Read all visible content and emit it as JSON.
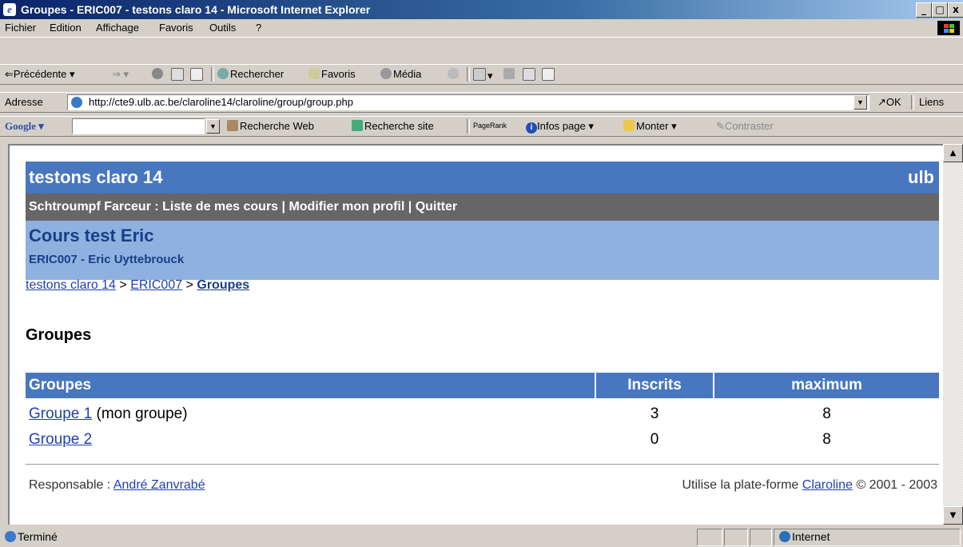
{
  "window": {
    "title": "Groupes - ERIC007 - testons claro 14 - Microsoft Internet Explorer",
    "min_glyph": "_",
    "max_glyph": "□",
    "close_glyph": "x"
  },
  "menu": {
    "items": [
      "Fichier",
      "Edition",
      "Affichage",
      "Favoris",
      "Outils",
      "?"
    ]
  },
  "toolbar": {
    "back": "Précédente",
    "search": "Rechercher",
    "favorites": "Favoris",
    "media": "Média"
  },
  "address": {
    "label": "Adresse",
    "url": "http://cte9.ulb.ac.be/claroline14/claroline/group/group.php",
    "go": "OK",
    "links": "Liens"
  },
  "google_bar": {
    "brand": "Google",
    "search_value": "",
    "web_search": "Recherche Web",
    "site_search": "Recherche site",
    "pagerank": "PageRank",
    "page_info": "Infos page",
    "up": "Monter",
    "highlight": "Contraster"
  },
  "page": {
    "campus_name": "testons claro 14",
    "institution": "ulb",
    "user_bar": "Schtroumpf Farceur : Liste de mes cours | Modifier mon profil | Quitter",
    "course_title": "Cours test Eric",
    "course_code_teacher": "ERIC007 - Eric Uyttebrouck",
    "breadcrumb": {
      "home": "testons claro 14",
      "sep1": ">",
      "course": "ERIC007",
      "sep2": ">",
      "current": "Groupes"
    },
    "heading": "Groupes",
    "table": {
      "headers": [
        "Groupes",
        "Inscrits",
        "maximum"
      ],
      "rows": [
        {
          "name": "Groupe 1",
          "note": "(mon groupe)",
          "enrolled": "3",
          "max": "8"
        },
        {
          "name": "Groupe 2",
          "note": "",
          "enrolled": "0",
          "max": "8"
        }
      ]
    },
    "footer": {
      "manager_label": "Responsable :",
      "manager_name": "André Zanvrabé",
      "platform_prefix": "Utilise la plate-forme",
      "platform_name": "Claroline",
      "platform_suffix": "© 2001 - 2003"
    }
  },
  "status": {
    "text": "Terminé",
    "zone": "Internet"
  },
  "colors": {
    "banner": "#4877bf",
    "user_bar": "#666666",
    "course_bar": "#8eb1e0",
    "link": "#1f3fb6"
  }
}
